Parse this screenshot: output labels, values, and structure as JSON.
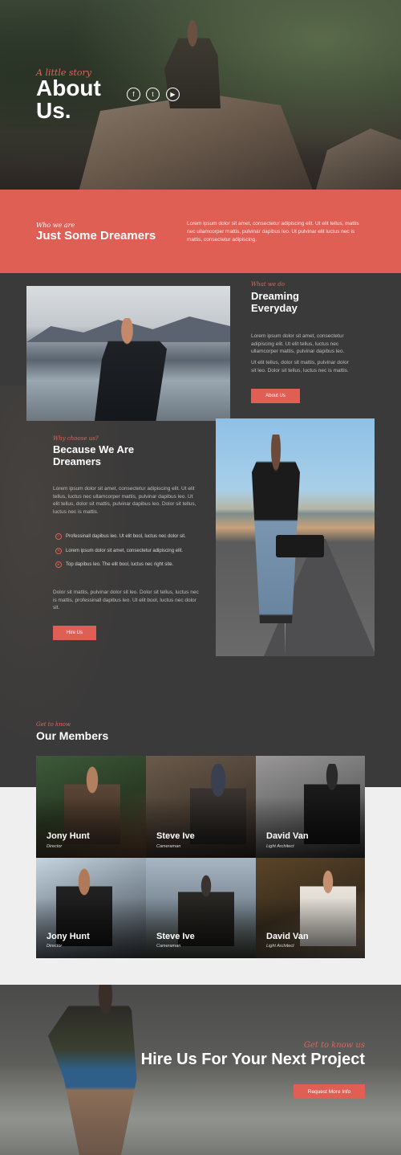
{
  "hero": {
    "kicker": "A little story",
    "title_line1": "About",
    "title_line2": "Us.",
    "social": [
      {
        "icon": "facebook-icon",
        "glyph": "f"
      },
      {
        "icon": "twitter-icon",
        "glyph": "t"
      },
      {
        "icon": "youtube-icon",
        "glyph": "▶"
      }
    ]
  },
  "intro": {
    "kicker": "Who we are",
    "title": "Just Some Dreamers",
    "text": "Lorem ipsum dolor sit amet, consectetur adipiscing elit. Ut elit tellus, mattis nec ullamcorper mattis, pulvinar dapibus leo. Ut pulvinar elit luctus nec is mattis, consectetur adipiscing."
  },
  "dreaming": {
    "kicker": "What we do",
    "title_line1": "Dreaming",
    "title_line2": "Everyday",
    "text1": "Lorem ipsum dolor sit amet, consectetur adipiscing elit. Ut elit tellus, luctus nec ullamcorper mattis, pulvinar dapibus leo.",
    "text2": "Ut elit tellus, dolor sit mattis, pulvinar dolor sit leo. Dolor sit tellus, luctus nec is mattis.",
    "button": "About Us"
  },
  "because": {
    "kicker": "Why choose us?",
    "title_line1": "Because We Are",
    "title_line2": "Dreamers",
    "text": "Lorem ipsum dolor sit amet, consectetur adipiscing elit. Ut elit tellus, luctus nec ullamcorper mattis, pulvinar dapibus leo. Ut elit tellus, dolor sit mattis, pulvinar dapibus leo. Dolor sit tellus, luctus nec is mattis.",
    "features": [
      {
        "icon": "check-circle-icon",
        "glyph": "✓",
        "text": "Professinall dapibus leo. Ut elit bool, luctus nec dolor sit."
      },
      {
        "icon": "x-circle-icon",
        "glyph": "✕",
        "text": "Lorem ipsum dolor sit amet, consectetur adipiscing elit."
      },
      {
        "icon": "play-circle-icon",
        "glyph": "▸",
        "text": "Top dapibus leo. The elit bool, luctus nec right site."
      }
    ],
    "text2": "Dolor sit mattis, pulvinar dolor sit leo. Dolor sit tellus, luctus nec is mattis, professinall dapibus leo. Ut elit bool, luctus nec dolor sit.",
    "button": "Hire Us"
  },
  "members": {
    "kicker": "Get to know",
    "title": "Our Members",
    "cards": [
      {
        "name": "Jony Hunt",
        "role": "Director"
      },
      {
        "name": "Steve Ive",
        "role": "Cameraman"
      },
      {
        "name": "David Van",
        "role": "Light Architect"
      },
      {
        "name": "Jony Hunt",
        "role": "Director"
      },
      {
        "name": "Steve Ive",
        "role": "Cameraman"
      },
      {
        "name": "David Van",
        "role": "Light Architect"
      }
    ]
  },
  "cta": {
    "kicker": "Get to know us",
    "title": "Hire Us For Your Next Project",
    "button": "Request More Info"
  }
}
